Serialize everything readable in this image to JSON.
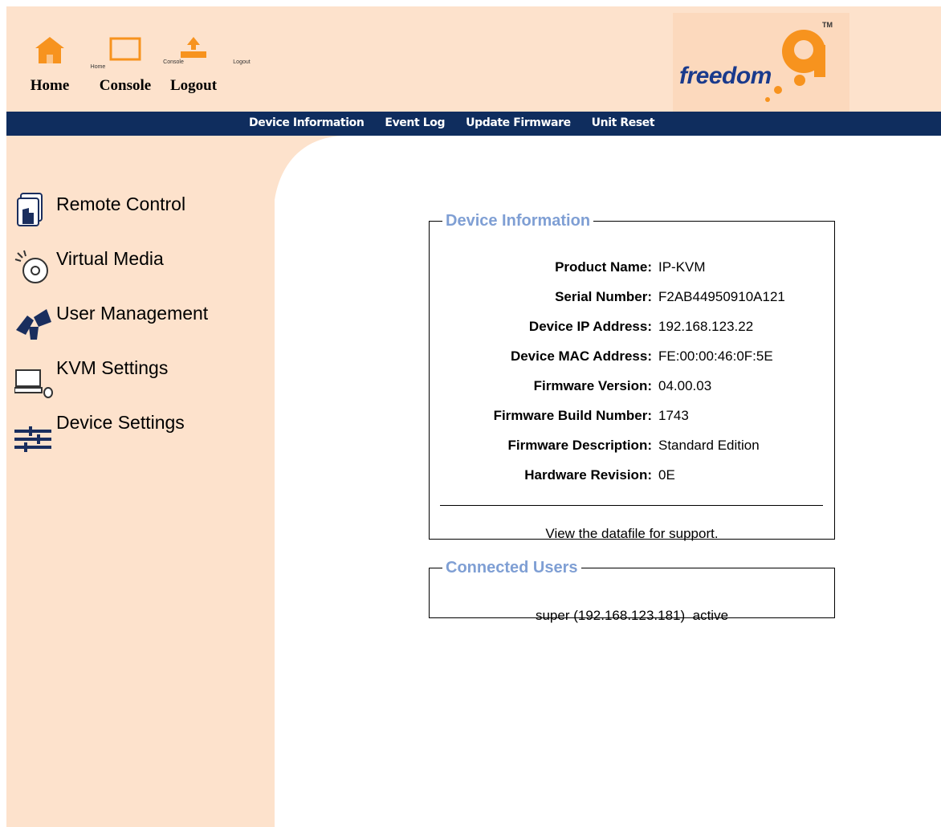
{
  "toolbar": {
    "home": {
      "icon_caption": "Home",
      "label": "Home"
    },
    "console": {
      "icon_caption": "Console",
      "label": "Console"
    },
    "logout": {
      "icon_caption": "Logout",
      "label": "Logout"
    }
  },
  "logo": {
    "text": "freedom",
    "numeral": "9",
    "tm": "TM"
  },
  "menu": [
    "Device Information",
    "Event Log",
    "Update Firmware",
    "Unit Reset"
  ],
  "sidebar": {
    "items": [
      {
        "label": "Remote Control",
        "icon": "remote-control-icon"
      },
      {
        "label": "Virtual Media",
        "icon": "virtual-media-icon"
      },
      {
        "label": "User Management",
        "icon": "user-management-icon"
      },
      {
        "label": "KVM Settings",
        "icon": "kvm-settings-icon"
      },
      {
        "label": "Device Settings",
        "icon": "device-settings-icon"
      }
    ]
  },
  "device_info": {
    "legend": "Device Information",
    "rows": [
      {
        "key": "Product Name:",
        "value": "IP-KVM"
      },
      {
        "key": "Serial Number:",
        "value": "F2AB44950910A121"
      },
      {
        "key": "Device IP Address:",
        "value": "192.168.123.22"
      },
      {
        "key": "Device MAC Address:",
        "value": "FE:00:00:46:0F:5E"
      },
      {
        "key": "Firmware Version:",
        "value": "04.00.03"
      },
      {
        "key": "Firmware Build Number:",
        "value": "1743"
      },
      {
        "key": "Firmware Description:",
        "value": "Standard Edition"
      },
      {
        "key": "Hardware Revision:",
        "value": "0E"
      }
    ],
    "support_link": "View the datafile for support."
  },
  "connected_users": {
    "legend": "Connected Users",
    "entry": "super (192.168.123.181)  active"
  },
  "colors": {
    "peach": "#fde2cc",
    "navy": "#0f2d5e",
    "legend_blue": "#7f9fd4",
    "orange": "#f7931e"
  }
}
